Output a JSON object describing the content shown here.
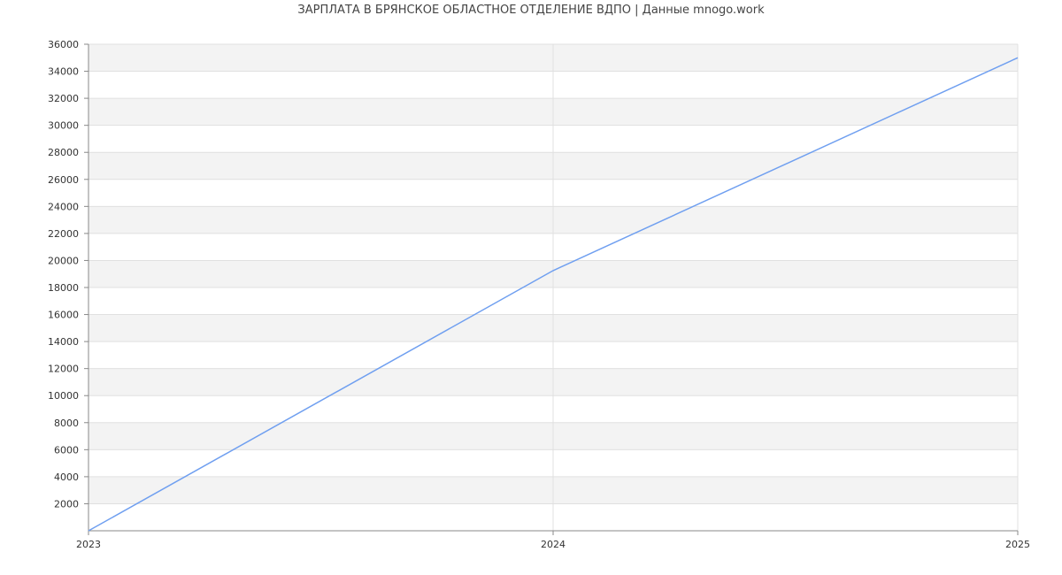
{
  "chart_data": {
    "type": "line",
    "title": "ЗАРПЛАТА В БРЯНСКОЕ ОБЛАСТНОЕ ОТДЕЛЕНИЕ ВДПО | Данные mnogo.work",
    "x": [
      "2023",
      "2024",
      "2025"
    ],
    "series": [
      {
        "values": [
          0,
          19250,
          35000
        ]
      }
    ],
    "y_ticks": [
      "2000",
      "4000",
      "6000",
      "8000",
      "10000",
      "12000",
      "14000",
      "16000",
      "18000",
      "20000",
      "22000",
      "24000",
      "26000",
      "28000",
      "30000",
      "32000",
      "34000",
      "36000"
    ],
    "ylim": [
      0,
      36000
    ],
    "xlabel": "",
    "ylabel": "",
    "grid": true,
    "legend": "none",
    "colors": {
      "line": "#6f9ff0",
      "band": "#f3f3f3",
      "grid": "#e0e0e0",
      "axis": "#888888"
    }
  }
}
